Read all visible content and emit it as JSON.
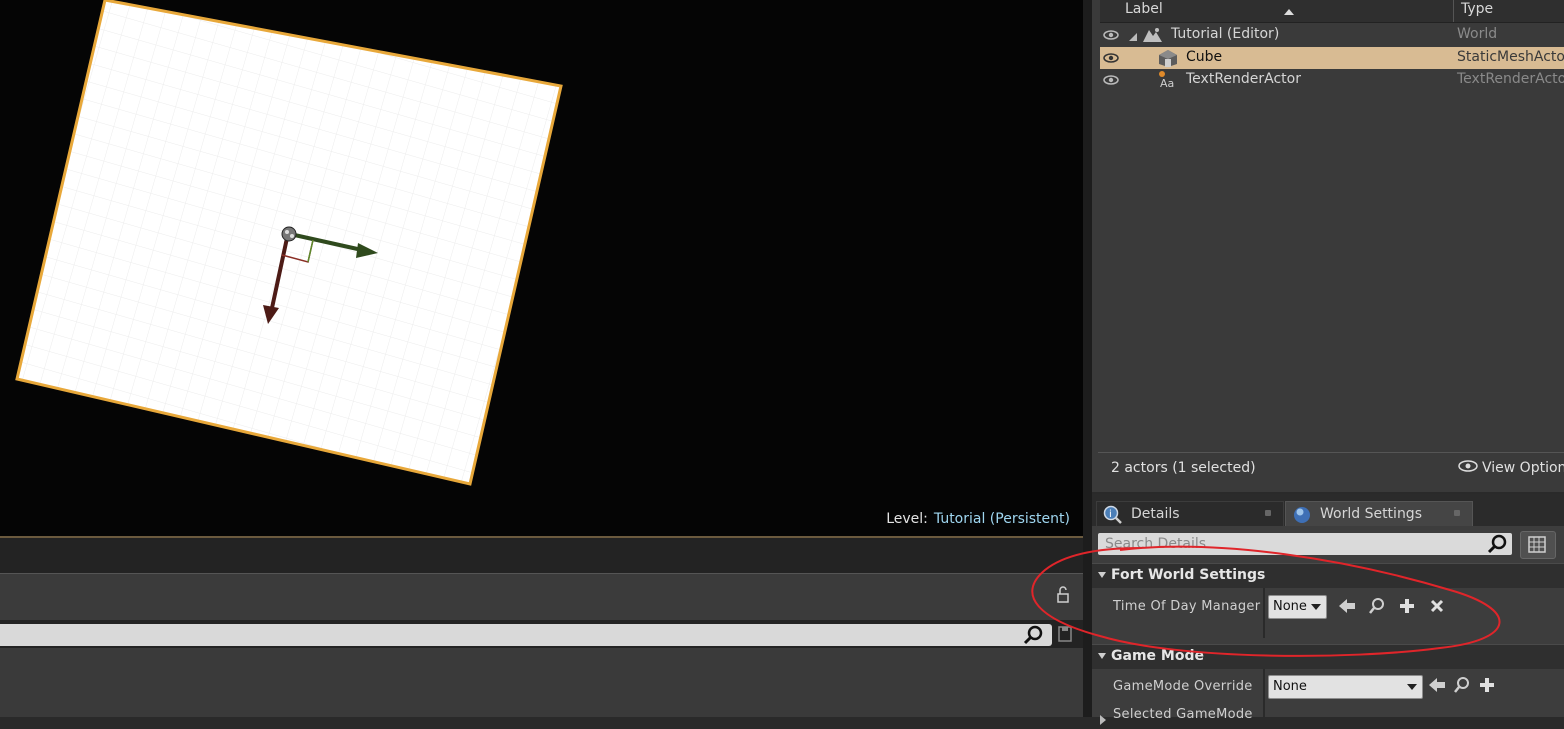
{
  "viewport": {
    "level_label": "Level:",
    "level_name": "Tutorial (Persistent)"
  },
  "outliner": {
    "col_label": "Label",
    "col_type": "Type",
    "rows": [
      {
        "label": "Tutorial (Editor)",
        "type": "World",
        "icon": "world-icon",
        "selected": false
      },
      {
        "label": "Cube",
        "type": "StaticMeshActor",
        "icon": "static-mesh-icon",
        "selected": true
      },
      {
        "label": "TextRenderActor",
        "type": "TextRenderActor",
        "icon": "text-render-icon",
        "selected": false
      }
    ],
    "footer": "2 actors (1 selected)",
    "view_options": "View Options"
  },
  "details": {
    "tabs": [
      {
        "label": "Details",
        "icon": "info-magnifier-icon",
        "active": false
      },
      {
        "label": "World Settings",
        "icon": "globe-icon",
        "active": true
      }
    ],
    "search_placeholder": "Search Details",
    "sections": [
      {
        "title": "Fort World Settings",
        "properties": [
          {
            "name": "Time Of Day Manager",
            "value": "None"
          }
        ]
      },
      {
        "title": "Game Mode",
        "properties": [
          {
            "name": "GameMode Override",
            "value": "None"
          },
          {
            "name": "Selected GameMode",
            "value": ""
          }
        ]
      }
    ]
  },
  "colors": {
    "selection": "#d8bb93",
    "annotation": "#e0252a",
    "gizmo_x": "#3a5a22",
    "gizmo_y": "#5a1f1a",
    "cube_outline": "#e8a83a"
  }
}
